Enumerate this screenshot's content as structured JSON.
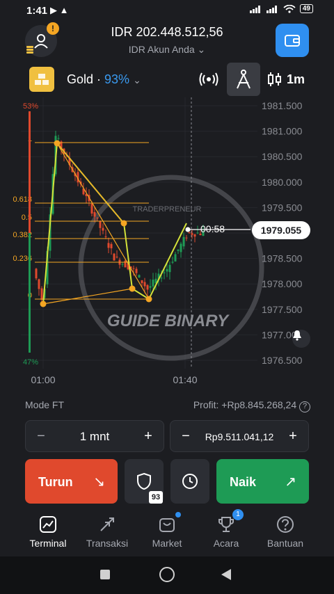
{
  "status": {
    "time": "1:41",
    "battery": "49"
  },
  "header": {
    "balance": "IDR 202.448.512,56",
    "account": "IDR Akun Anda",
    "avatar_badge": "!"
  },
  "asset": {
    "name": "Gold",
    "separator": " · ",
    "payout": "93%",
    "timeframe": "1m"
  },
  "chart_data": {
    "type": "candlestick",
    "y_ticks": [
      "1981.500",
      "1981.000",
      "1980.500",
      "1980.000",
      "1979.500",
      "1979.000",
      "1978.500",
      "1978.000",
      "1977.500",
      "1977.000",
      "1976.500"
    ],
    "x_ticks": [
      "01:00",
      "01:40"
    ],
    "ylim": [
      1976.5,
      1981.5
    ],
    "current_price": "1979.055",
    "timer": "00:58",
    "sentiment_top": "53%",
    "sentiment_bottom": "47%",
    "fib_levels": [
      "1",
      "0.618",
      "0.5",
      "0.382",
      "0.236",
      "0"
    ],
    "watermark": "GUIDE BINARY",
    "watermark_sub": "TRADERPRENEUR",
    "colors": {
      "up": "#1e9b55",
      "down": "#e0492d",
      "fib": "#f5a623",
      "pattern": "#d4e23a"
    }
  },
  "mode": {
    "label": "Mode FT",
    "profit": "Profit: +Rp8.845.268,24"
  },
  "duration": {
    "minus": "−",
    "value": "1 mnt",
    "plus": "+"
  },
  "amount": {
    "minus": "−",
    "value": "Rp9.511.041,12",
    "plus": "+"
  },
  "actions": {
    "down": "Turun",
    "up": "Naik",
    "shield_count": "93"
  },
  "nav": [
    {
      "label": "Terminal",
      "icon": "chart-icon"
    },
    {
      "label": "Transaksi",
      "icon": "transactions-icon"
    },
    {
      "label": "Market",
      "icon": "market-icon"
    },
    {
      "label": "Acara",
      "icon": "trophy-icon"
    },
    {
      "label": "Bantuan",
      "icon": "help-icon"
    }
  ],
  "nav_badge": "1"
}
